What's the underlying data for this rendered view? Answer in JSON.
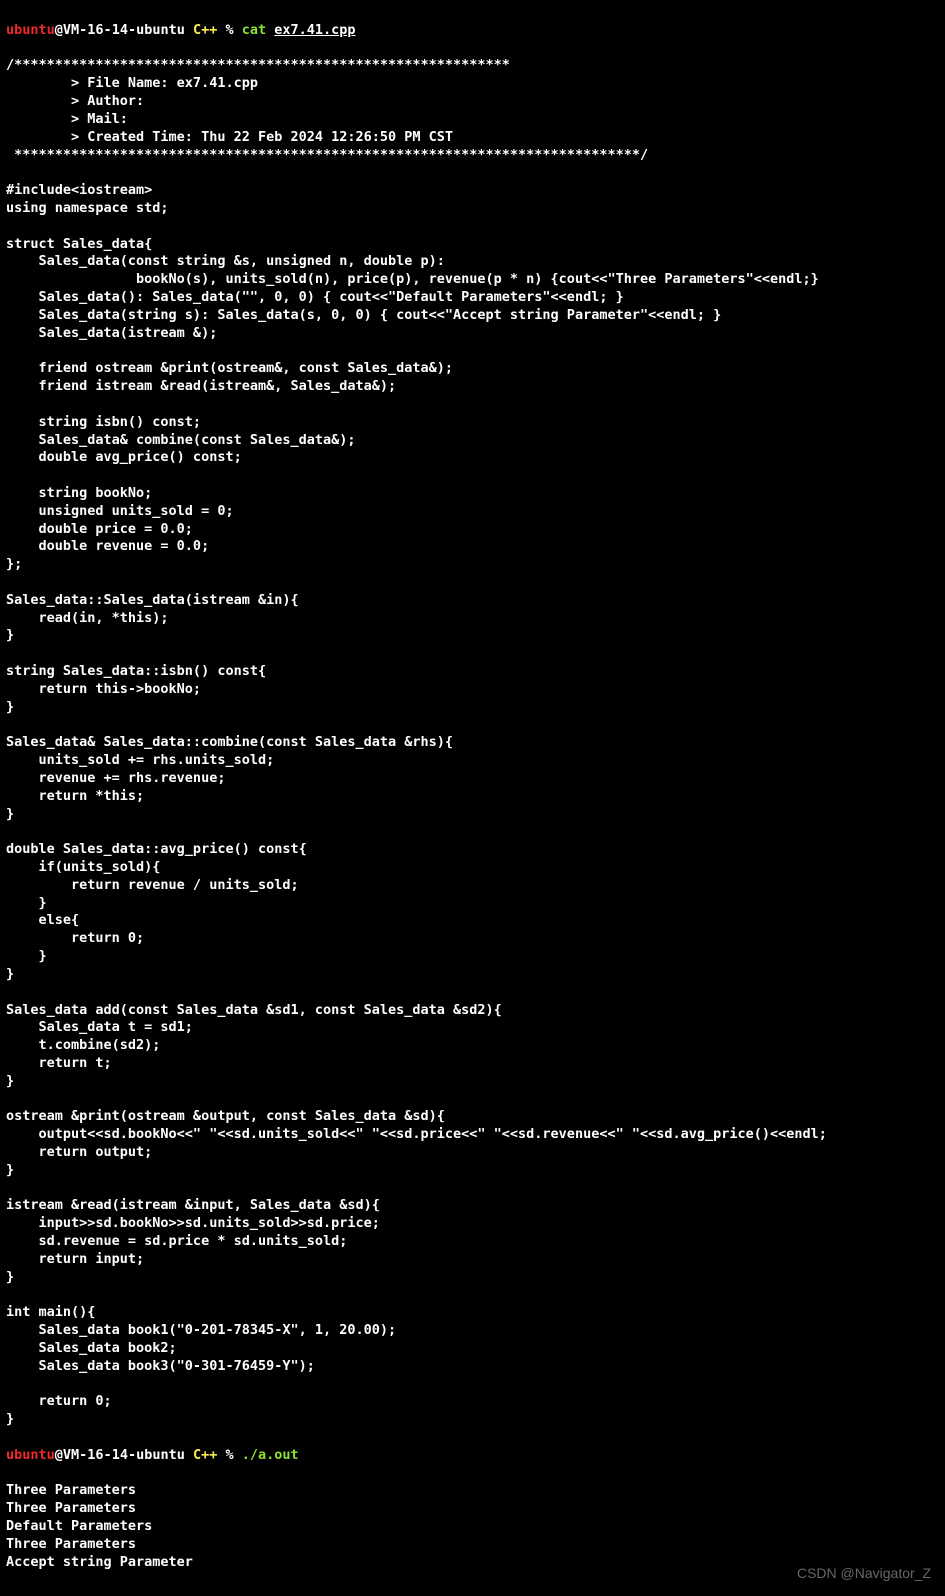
{
  "prompt": {
    "user": "ubuntu",
    "at": "@",
    "host": "VM-16-14-ubuntu",
    "lang": " C++ ",
    "sep": "% "
  },
  "cmd1": {
    "cmd": "cat ",
    "arg": "ex7.41.cpp"
  },
  "cmd2": {
    "cmd": "./a.out"
  },
  "code_lines": [
    "/*************************************************************",
    "        > File Name: ex7.41.cpp",
    "        > Author:",
    "        > Mail:",
    "        > Created Time: Thu 22 Feb 2024 12:26:50 PM CST",
    " *****************************************************************************/",
    "",
    "#include<iostream>",
    "using namespace std;",
    "",
    "struct Sales_data{",
    "    Sales_data(const string &s, unsigned n, double p):",
    "                bookNo(s), units_sold(n), price(p), revenue(p * n) {cout<<\"Three Parameters\"<<endl;}",
    "    Sales_data(): Sales_data(\"\", 0, 0) { cout<<\"Default Parameters\"<<endl; }",
    "    Sales_data(string s): Sales_data(s, 0, 0) { cout<<\"Accept string Parameter\"<<endl; }",
    "    Sales_data(istream &);",
    "",
    "    friend ostream &print(ostream&, const Sales_data&);",
    "    friend istream &read(istream&, Sales_data&);",
    "",
    "    string isbn() const;",
    "    Sales_data& combine(const Sales_data&);",
    "    double avg_price() const;",
    "",
    "    string bookNo;",
    "    unsigned units_sold = 0;",
    "    double price = 0.0;",
    "    double revenue = 0.0;",
    "};",
    "",
    "Sales_data::Sales_data(istream &in){",
    "    read(in, *this);",
    "}",
    "",
    "string Sales_data::isbn() const{",
    "    return this->bookNo;",
    "}",
    "",
    "Sales_data& Sales_data::combine(const Sales_data &rhs){",
    "    units_sold += rhs.units_sold;",
    "    revenue += rhs.revenue;",
    "    return *this;",
    "}",
    "",
    "double Sales_data::avg_price() const{",
    "    if(units_sold){",
    "        return revenue / units_sold;",
    "    }",
    "    else{",
    "        return 0;",
    "    }",
    "}",
    "",
    "Sales_data add(const Sales_data &sd1, const Sales_data &sd2){",
    "    Sales_data t = sd1;",
    "    t.combine(sd2);",
    "    return t;",
    "}",
    "",
    "ostream &print(ostream &output, const Sales_data &sd){",
    "    output<<sd.bookNo<<\" \"<<sd.units_sold<<\" \"<<sd.price<<\" \"<<sd.revenue<<\" \"<<sd.avg_price()<<endl;",
    "    return output;",
    "}",
    "",
    "istream &read(istream &input, Sales_data &sd){",
    "    input>>sd.bookNo>>sd.units_sold>>sd.price;",
    "    sd.revenue = sd.price * sd.units_sold;",
    "    return input;",
    "}",
    "",
    "int main(){",
    "    Sales_data book1(\"0-201-78345-X\", 1, 20.00);",
    "    Sales_data book2;",
    "    Sales_data book3(\"0-301-76459-Y\");",
    "",
    "    return 0;",
    "}"
  ],
  "output_lines": [
    "Three Parameters",
    "Three Parameters",
    "Default Parameters",
    "Three Parameters",
    "Accept string Parameter"
  ],
  "watermark": "CSDN @Navigator_Z"
}
